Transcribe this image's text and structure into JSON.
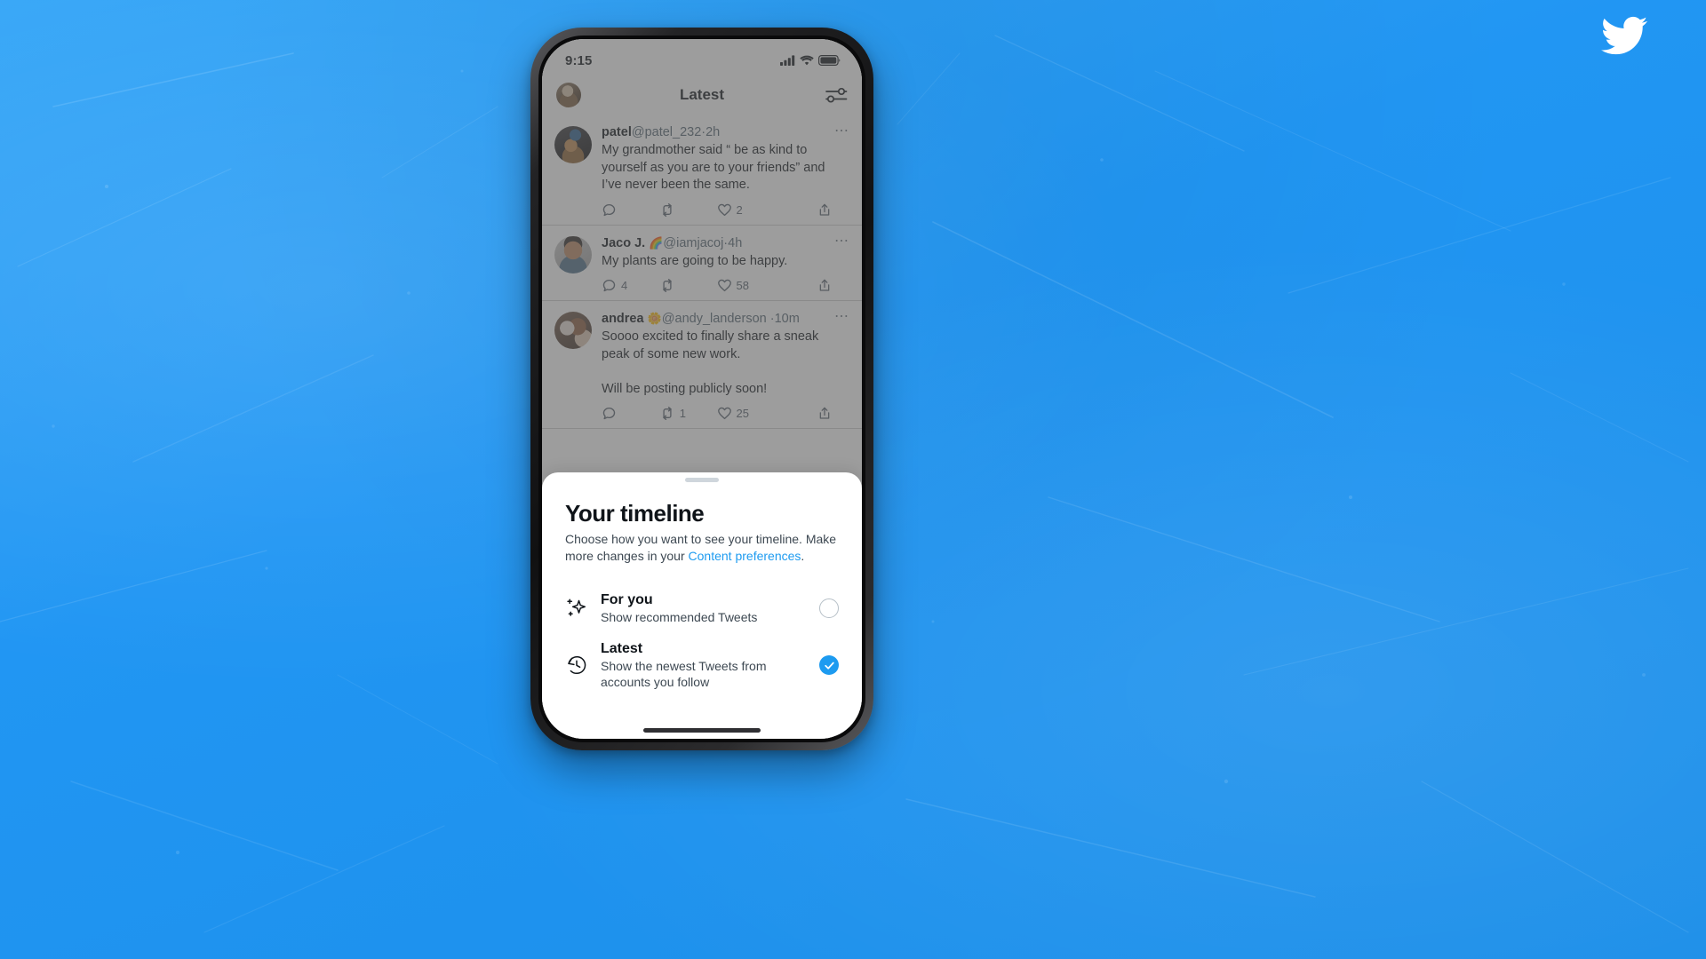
{
  "background": {
    "color": "#2196f3",
    "logo_icon": "twitter-bird-icon"
  },
  "phone": {
    "status_bar": {
      "time": "9:15",
      "icons": [
        "cellular-signal-icon",
        "wifi-icon",
        "battery-icon"
      ]
    },
    "app_header": {
      "title": "Latest",
      "avatar_icon": "profile-avatar",
      "settings_icon": "sliders-icon"
    },
    "tweets": [
      {
        "avatar_class": "av-patel",
        "name": "patel",
        "emoji": "",
        "handle": "@patel_232",
        "separator": "·",
        "time": "2h",
        "text": "My grandmother said “ be as kind to yourself as you are to your friends” and I’ve never been the same.",
        "more_icon": "more-options-icon",
        "actions": {
          "reply_count": "",
          "retweet_count": "",
          "like_count": "2",
          "share_icon": "share-icon"
        }
      },
      {
        "avatar_class": "av-jaco",
        "name": "Jaco J.",
        "emoji": "🌈",
        "handle": "@iamjacoj",
        "separator": "·",
        "time": "4h",
        "text": "My plants are going to be happy.",
        "more_icon": "more-options-icon",
        "actions": {
          "reply_count": "4",
          "retweet_count": "",
          "like_count": "58",
          "share_icon": "share-icon"
        }
      },
      {
        "avatar_class": "av-andrea",
        "name": "andrea",
        "emoji": "🌼",
        "handle": "@andy_landerson",
        "separator": "·",
        "time": "10m",
        "text": "Soooo excited to finally share a sneak peak of some new work.\n\nWill be posting publicly soon!",
        "more_icon": "more-options-icon",
        "actions": {
          "reply_count": "",
          "retweet_count": "1",
          "like_count": "25",
          "share_icon": "share-icon"
        }
      }
    ],
    "sheet": {
      "title": "Your timeline",
      "subtitle_part1": "Choose how you want to see your timeline. Make more changes in your ",
      "subtitle_link": "Content preferences",
      "subtitle_part2": ".",
      "options": [
        {
          "icon": "sparkle-icon",
          "title": "For you",
          "description": "Show recommended Tweets",
          "selected": false
        },
        {
          "icon": "history-clock-icon",
          "title": "Latest",
          "description": "Show the newest Tweets from accounts you follow",
          "selected": true
        }
      ],
      "accent_color": "#1d9bf0"
    }
  }
}
